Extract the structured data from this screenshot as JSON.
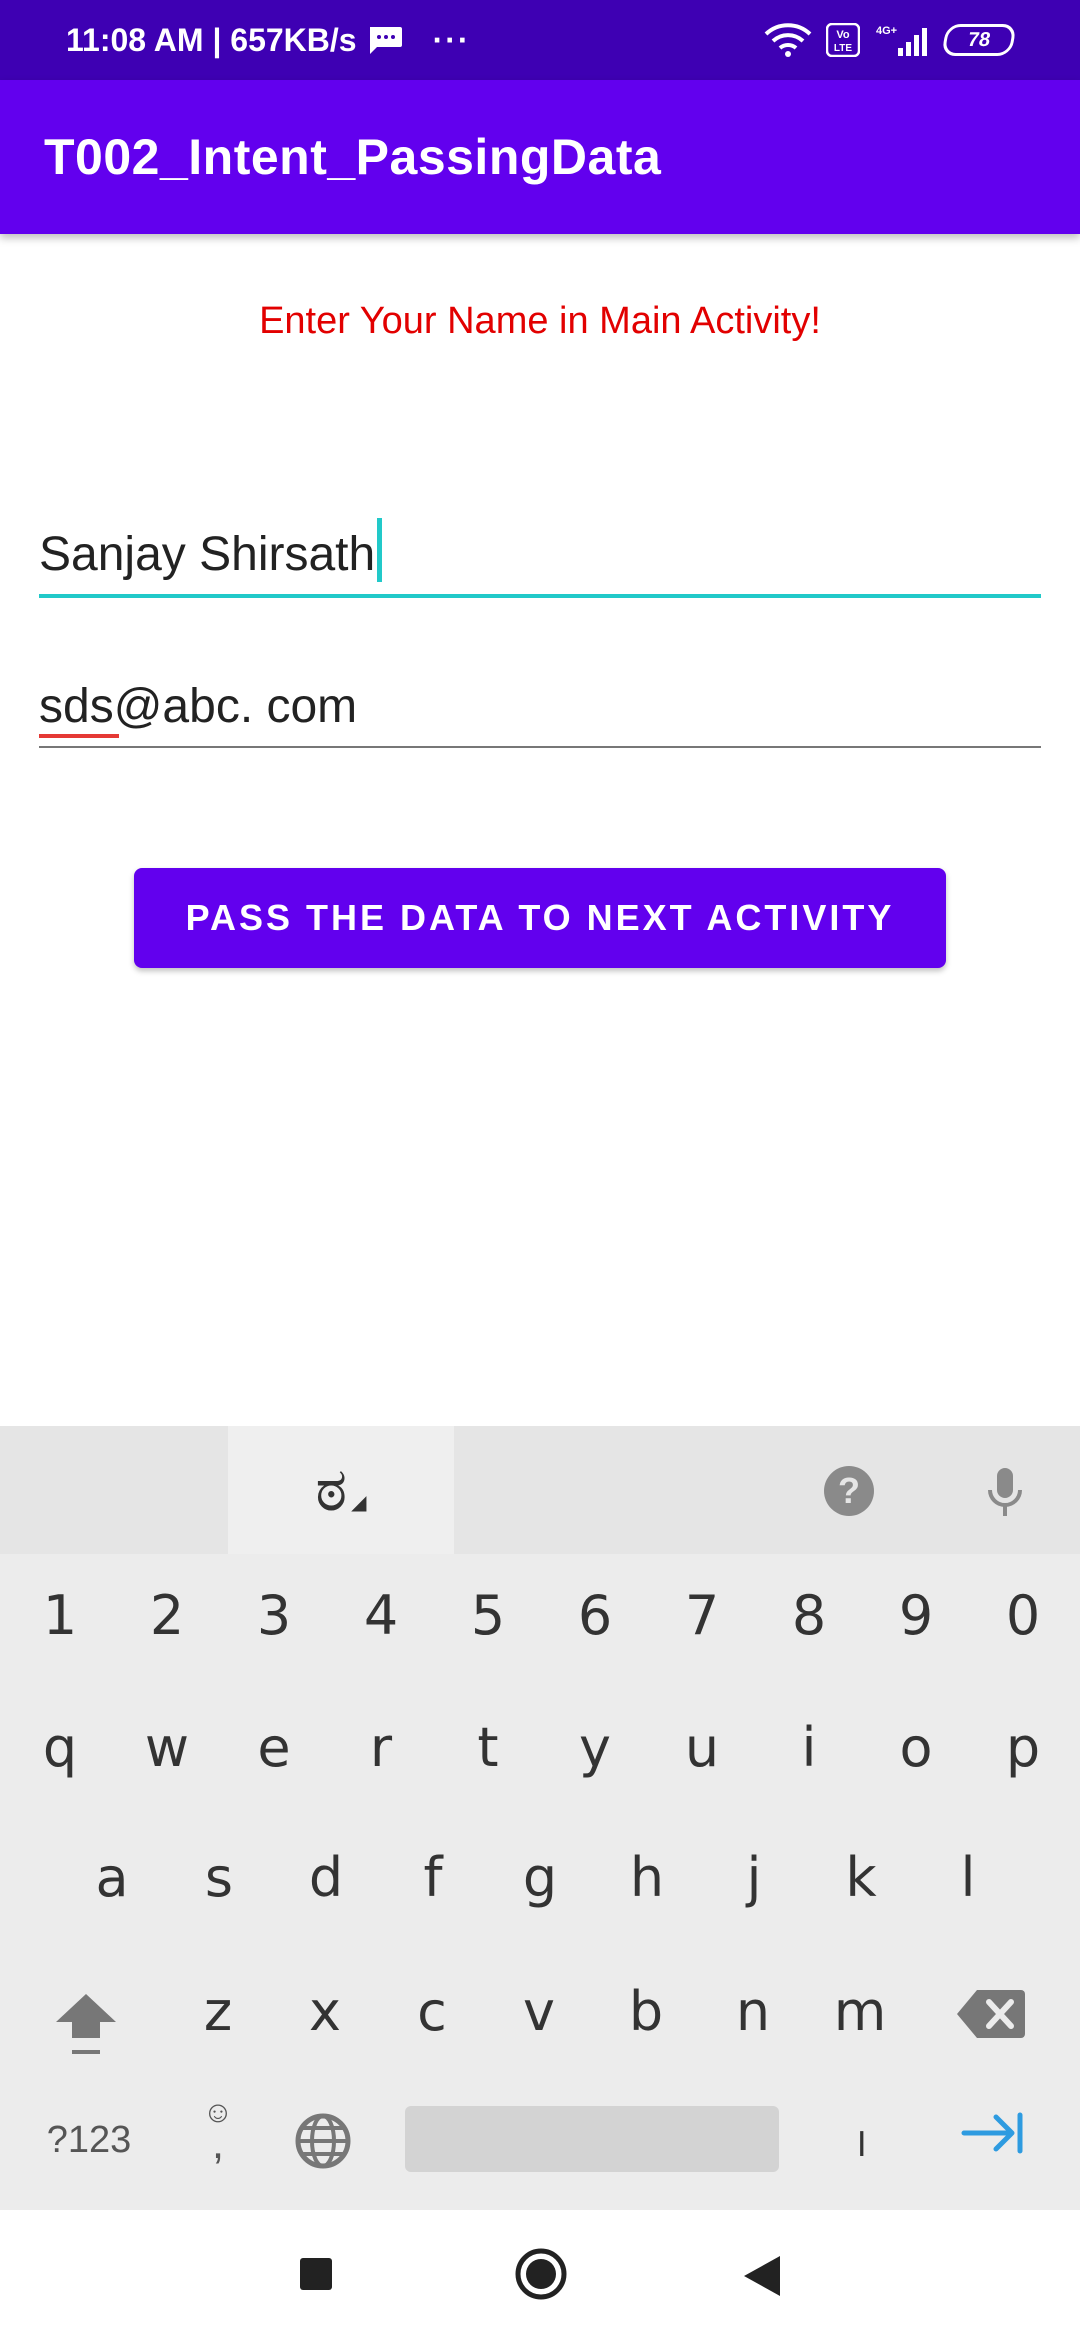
{
  "status_bar": {
    "time_speed": "11:08 AM | 657KB/s",
    "more": "···",
    "battery": "78",
    "network_label": "4G+",
    "volte_label": "Vo LTE"
  },
  "app_bar": {
    "title": "T002_Intent_PassingData",
    "color": "#6200ee"
  },
  "main": {
    "prompt": "Enter Your Name in Main Activity!",
    "prompt_color": "#e20000",
    "name_field_value": "Sanjay Shirsath",
    "email_field_value": "sds@abc. com",
    "pass_button_label": "PASS THE DATA TO NEXT ACTIVITY"
  },
  "keyboard": {
    "language_glyph": "ಠ",
    "number_row": [
      "1",
      "2",
      "3",
      "4",
      "5",
      "6",
      "7",
      "8",
      "9",
      "0"
    ],
    "row1": [
      "q",
      "w",
      "e",
      "r",
      "t",
      "y",
      "u",
      "i",
      "o",
      "p"
    ],
    "row2": [
      "a",
      "s",
      "d",
      "f",
      "g",
      "h",
      "j",
      "k",
      "l"
    ],
    "row3": [
      "z",
      "x",
      "c",
      "v",
      "b",
      "n",
      "m"
    ],
    "symbols_label": "?123",
    "emoji_smile": "☺",
    "emoji_comma": ",",
    "period": "।",
    "help": "?"
  }
}
